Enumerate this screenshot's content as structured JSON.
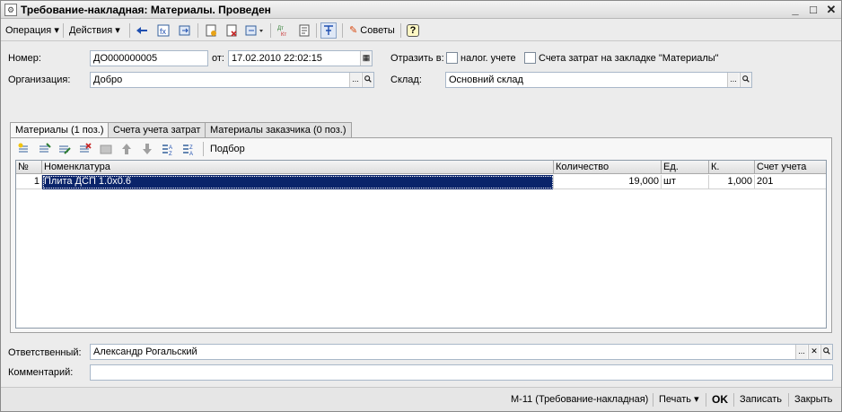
{
  "window": {
    "title": "Требование-накладная: Материалы. Проведен",
    "minimize_glyph": "_",
    "maximize_glyph": "□",
    "close_glyph": "✕"
  },
  "toolbar": {
    "operation_label": "Операция",
    "actions_label": "Действия",
    "tips_label": "Советы",
    "help_label": "?",
    "dropdown_glyph": "▾"
  },
  "form": {
    "number_label": "Номер:",
    "number_value": "ДО000000005",
    "date_label": "от:",
    "date_value": "17.02.2010 22:02:15",
    "reflect_label": "Отразить в:",
    "tax_check_label": "налог. учете",
    "cost_accounts_check_label": "Счета затрат на закладке \"Материалы\"",
    "org_label": "Организация:",
    "org_value": "Добро",
    "warehouse_label": "Склад:",
    "warehouse_value": "Основний склад",
    "select_glyph": "...",
    "search_glyph": "🔍"
  },
  "tabs": [
    {
      "label": "Материалы (1 поз.)"
    },
    {
      "label": "Счета учета затрат"
    },
    {
      "label": "Материалы заказчика (0 поз.)"
    }
  ],
  "table_toolbar": {
    "pick_label": "Подбор"
  },
  "table": {
    "columns": [
      "№",
      "Номенклатура",
      "Количество",
      "Ед.",
      "К.",
      "Счет учета"
    ],
    "rows": [
      {
        "num": "1",
        "item": "Плита ДСП 1.0х0.6",
        "qty": "19,000",
        "unit": "шт",
        "k": "1,000",
        "account": "201"
      }
    ]
  },
  "footer": {
    "responsible_label": "Ответственный:",
    "responsible_value": "Александр Рогальский",
    "clear_glyph": "✕",
    "comment_label": "Комментарий:",
    "comment_value": ""
  },
  "statusbar": {
    "form_name": "М-11 (Требование-накладная)",
    "print_label": "Печать",
    "ok_label": "OK",
    "save_label": "Записать",
    "close_label": "Закрыть"
  },
  "colors": {
    "selection": "#0a246a",
    "field_border": "#a9b8c9"
  }
}
